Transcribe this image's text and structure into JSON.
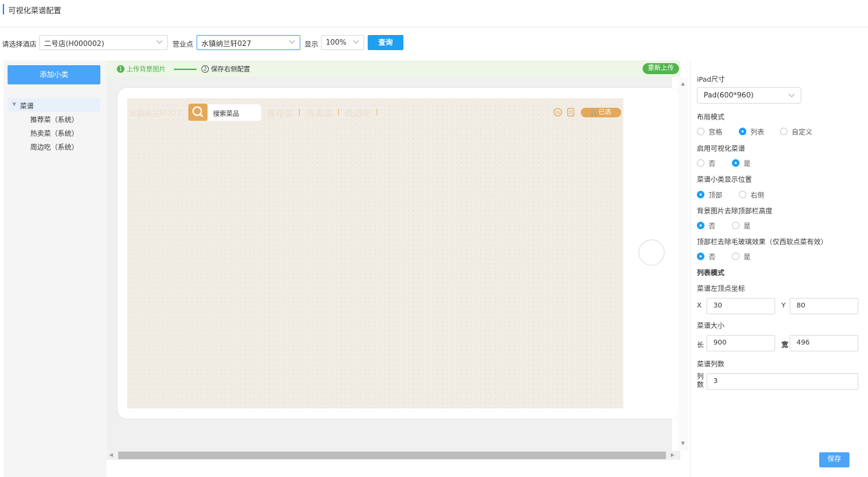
{
  "page": {
    "title": "可视化菜谱配置"
  },
  "filters": {
    "hotel_label": "请选择酒店",
    "hotel_value": "二号店(H000002)",
    "outlet_label": "营业点",
    "outlet_value": "水镇纳兰轩027",
    "display_label": "显示",
    "display_value": "100%",
    "query_label": "查询"
  },
  "sidebar": {
    "add_label": "添加小类",
    "tree_root": "菜谱",
    "items": [
      {
        "label": "推荐菜（系统）"
      },
      {
        "label": "热卖菜（系统）"
      },
      {
        "label": "周边吃（系统）"
      }
    ]
  },
  "steps": {
    "step1_num": "1",
    "step1_label": "上传背景图片",
    "step2_num": "2",
    "step2_label": "保存右侧配置",
    "reupload_label": "重新上传"
  },
  "preview": {
    "store_name": "水镇纳兰轩027",
    "search_placeholder": "搜索菜品",
    "tabs": [
      "推荐菜",
      "热卖菜",
      "周边吃"
    ],
    "cart_label": "已选",
    "accent_color": "#e4a85a"
  },
  "settings": {
    "ipad_size_label": "iPad尺寸",
    "ipad_size_value": "Pad(600*960)",
    "layout_mode_label": "布局模式",
    "layout_options": [
      "宫格",
      "列表",
      "自定义"
    ],
    "layout_selected": "列表",
    "enable_visual_label": "启用可视化菜谱",
    "enable_options": [
      "否",
      "是"
    ],
    "enable_selected": "是",
    "category_position_label": "菜谱小类显示位置",
    "position_options": [
      "顶部",
      "右侧"
    ],
    "position_selected": "顶部",
    "bg_remove_label": "背景图片去除顶部栏高度",
    "bg_remove_options": [
      "否",
      "是"
    ],
    "bg_remove_selected": "否",
    "frosted_label": "顶部栏去除毛玻璃效果（仅西软点菜有效）",
    "frosted_options": [
      "否",
      "是"
    ],
    "frosted_selected": "否",
    "list_mode_label": "列表模式",
    "coord_label": "菜谱左顶点坐标",
    "x_label": "X",
    "x_value": "30",
    "y_label": "Y",
    "y_value": "80",
    "size_label": "菜谱大小",
    "length_label": "长",
    "length_value": "900",
    "width_label": "宽",
    "width_value": "496",
    "columns_label": "菜谱列数",
    "columns_field_label": "列数",
    "columns_value": "3",
    "save_label": "保存"
  }
}
